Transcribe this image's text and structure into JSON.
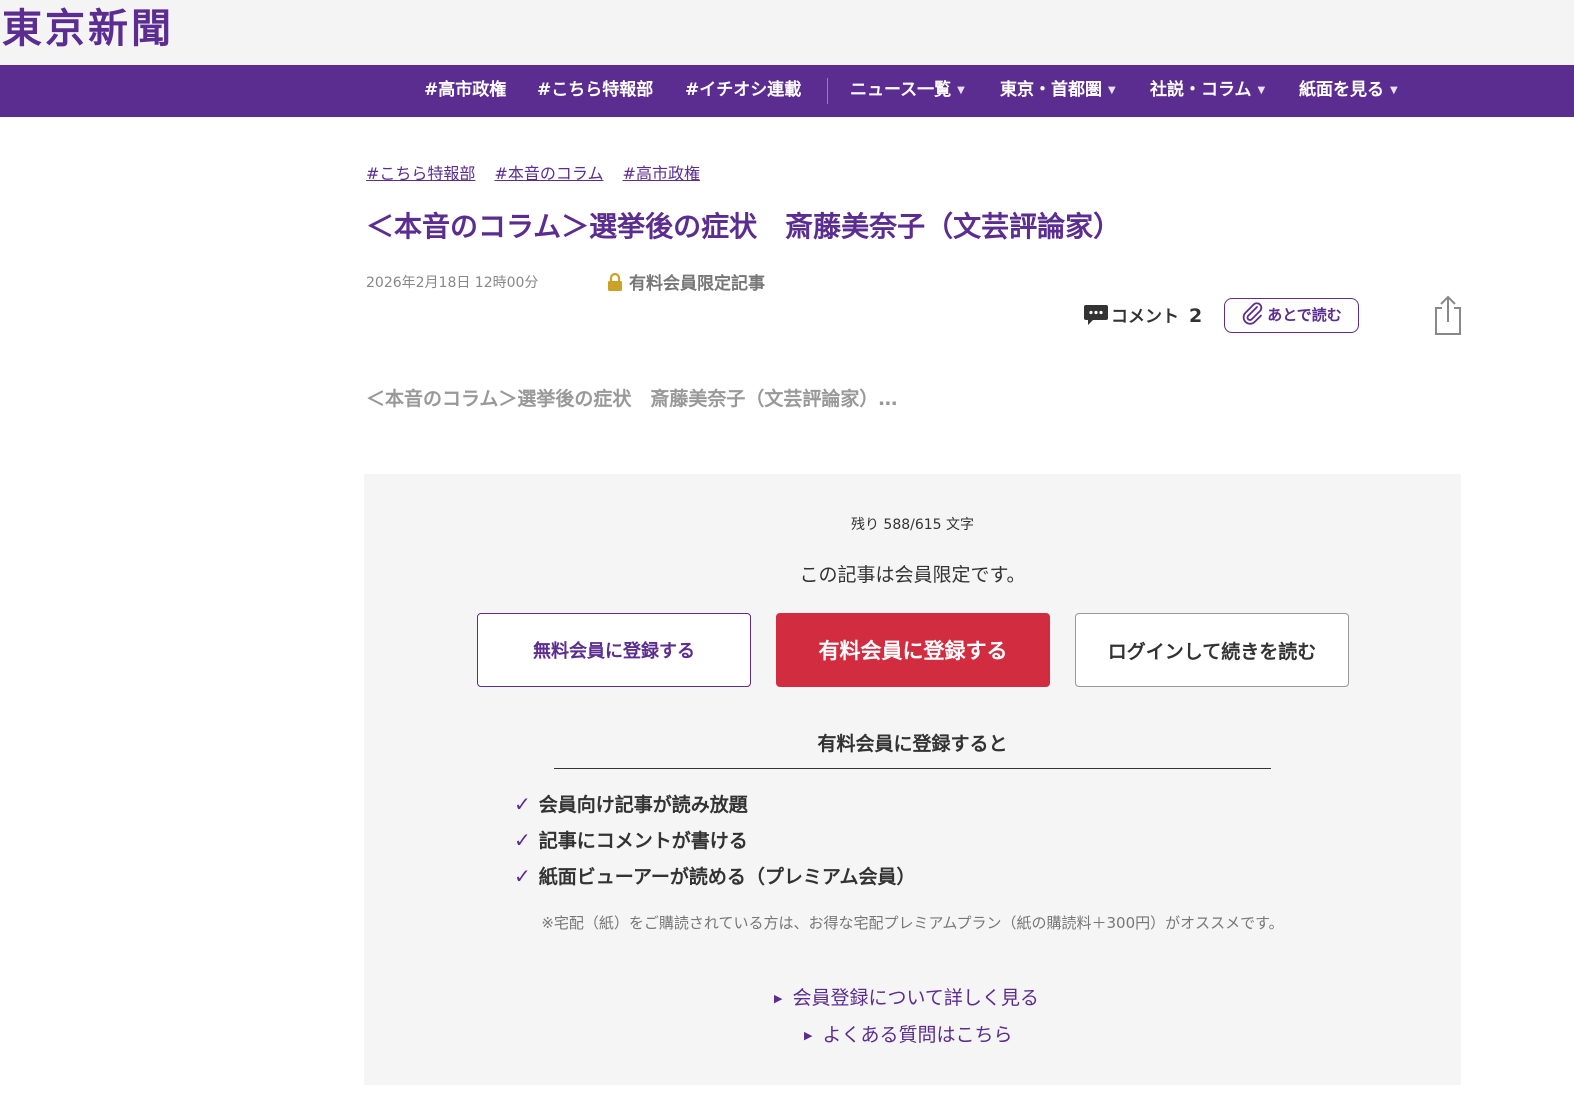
{
  "logo": "東京新聞",
  "colors": {
    "brand": "#5c2d91",
    "paid_button": "#d12c3f",
    "paywall_bg": "#f5f5f5"
  },
  "nav": {
    "hashtags": [
      "#高市政権",
      "#こちら特報部",
      "#イチオシ連載"
    ],
    "menus": [
      "ニュース一覧",
      "東京・首都圏",
      "社説・コラム",
      "紙面を見る"
    ]
  },
  "article": {
    "tags": [
      "#こちら特報部",
      "#本音のコラム",
      "#高市政権"
    ],
    "title": "＜本音のコラム＞選挙後の症状　斎藤美奈子（文芸評論家）",
    "date": "2026年2月18日 12時00分",
    "premium_label": "有料会員限定記事",
    "comment_label": "コメント",
    "comment_count": "2",
    "read_later": "あとで読む",
    "summary": "＜本音のコラム＞選挙後の症状　斎藤美奈子（文芸評論家）…"
  },
  "paywall": {
    "remaining": "残り 588/615 文字",
    "members_only": "この記事は会員限定です。",
    "free_button": "無料会員に登録する",
    "paid_button": "有料会員に登録する",
    "login_button": "ログインして続きを読む",
    "benefits_heading": "有料会員に登録すると",
    "benefits": [
      "会員向け記事が読み放題",
      "記事にコメントが書ける",
      "紙面ビューアーが読める（プレミアム会員）"
    ],
    "note": "※宅配（紙）をご購読されている方は、お得な宅配プレミアムプラン（紙の購読料＋300円）がオススメです。",
    "link_membership": "会員登録について詳しく見る",
    "link_faq": "よくある質問はこちら"
  },
  "icons": [
    "lock-icon",
    "comment-icon",
    "paperclip-icon",
    "share-icon",
    "check-icon",
    "chevron-down-icon",
    "triangle-right-icon"
  ]
}
